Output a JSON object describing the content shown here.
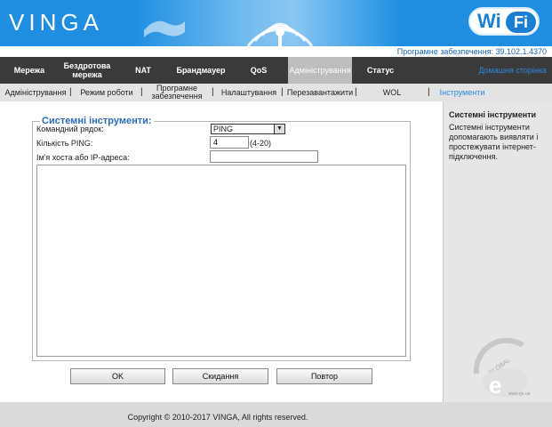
{
  "header": {
    "brand": "VINGA",
    "wifi_logo_left": "Wi",
    "wifi_logo_right": "Fi",
    "firmware": "Програмне забезпечення: 39.102.1.4370"
  },
  "nav": {
    "items": [
      {
        "label": "Мережа"
      },
      {
        "label": "Бездротова мережа"
      },
      {
        "label": "NAT"
      },
      {
        "label": "Брандмауер"
      },
      {
        "label": "QoS"
      },
      {
        "label": "Адміністрування"
      },
      {
        "label": "Статус"
      }
    ],
    "active": "Адміністрування",
    "home_link": "Домашня сторінка"
  },
  "subnav": {
    "items": [
      {
        "label": "Адміністрування"
      },
      {
        "label": "Режим роботи"
      },
      {
        "label": "Програмне забезпечення"
      },
      {
        "label": "Налаштування"
      },
      {
        "label": "Перезавантажити"
      },
      {
        "label": "WOL"
      },
      {
        "label": "Інструменти"
      }
    ],
    "active": "Інструменти"
  },
  "form": {
    "legend": "Системні інструменти:",
    "command_label": "Командний рядок:",
    "command_value": "PING",
    "ping_count_label": "Кількість PING:",
    "ping_count_value": "4",
    "ping_count_hint": "(4-20)",
    "host_label": "Ім'я хоста або IP-адреса:",
    "host_value": "",
    "output_text": ""
  },
  "buttons": {
    "ok": "OK",
    "cancel": "Скидання",
    "repeat": "Повтор"
  },
  "sidebar": {
    "title": "Системні інструменти",
    "text": "Системні інструменти допомагають виявляти і простежувати інтернет-підключення."
  },
  "footer": {
    "copyright": "Copyright © 2010-2017 VINGA, All rights reserved."
  },
  "watermark": {
    "text": "GLOBAL",
    "site": "www.ge.ua"
  },
  "colors": {
    "banner": "#1f8ee0",
    "nav_bg": "#3a3a3a",
    "nav_active": "#bdbdbd",
    "link": "#2a8ae0",
    "legend": "#2a6cb8"
  }
}
